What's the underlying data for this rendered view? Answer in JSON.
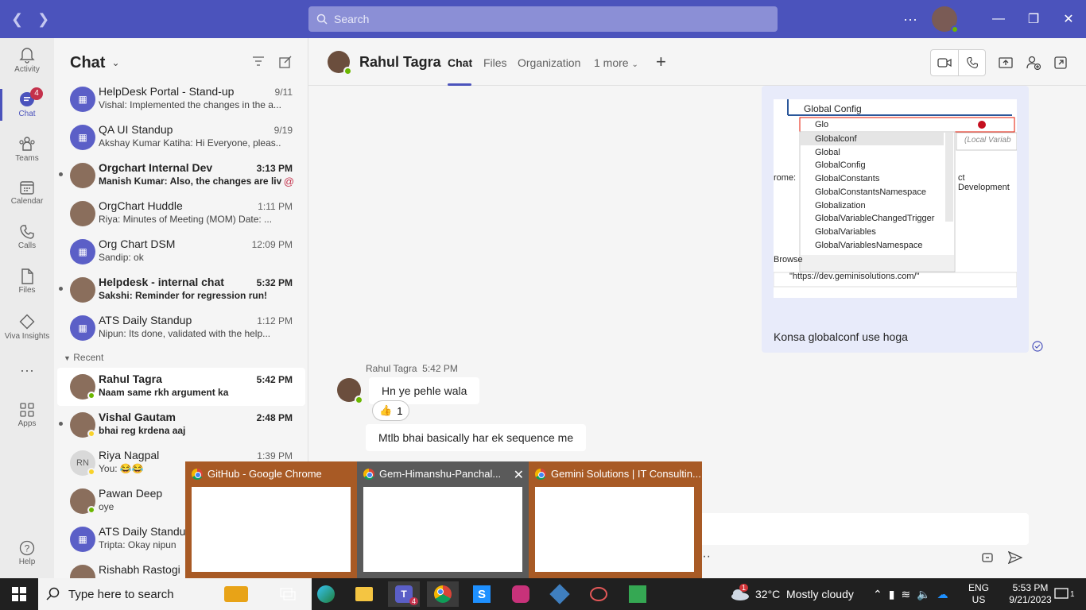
{
  "titlebar": {
    "search_placeholder": "Search",
    "more": "···"
  },
  "rail": {
    "items": [
      {
        "label": "Activity"
      },
      {
        "label": "Chat",
        "badge": "4"
      },
      {
        "label": "Teams"
      },
      {
        "label": "Calendar"
      },
      {
        "label": "Calls"
      },
      {
        "label": "Files"
      },
      {
        "label": "Viva Insights"
      },
      {
        "label": "···"
      },
      {
        "label": "Apps"
      },
      {
        "label": "Help"
      }
    ]
  },
  "sidebar": {
    "title": "Chat",
    "recent_label": "Recent",
    "chats": [
      {
        "name": "HelpDesk Portal - Stand-up",
        "preview": "Vishal: Implemented the changes in the a...",
        "time": "9/11",
        "unread": false,
        "type": "group"
      },
      {
        "name": "QA UI Standup",
        "preview": "Akshay Kumar Katiha: Hi Everyone, pleas...",
        "time": "9/19",
        "unread": false,
        "type": "group"
      },
      {
        "name": "Orgchart Internal Dev",
        "preview": "Manish Kumar: Also, the changes are liv...",
        "time": "3:13 PM",
        "unread": true,
        "type": "photo",
        "mention": "@"
      },
      {
        "name": "OrgChart Huddle",
        "preview": "Riya: Minutes of Meeting (MOM) Date: ...",
        "time": "1:11 PM",
        "unread": false,
        "type": "photo"
      },
      {
        "name": "Org Chart DSM",
        "preview": "Sandip: ok",
        "time": "12:09 PM",
        "unread": false,
        "type": "group"
      },
      {
        "name": "Helpdesk - internal chat",
        "preview": "Sakshi: Reminder for regression run!",
        "time": "5:32 PM",
        "unread": true,
        "type": "photo"
      },
      {
        "name": "ATS Daily Standup",
        "preview": "Nipun: Its done, validated with the help...",
        "time": "1:12 PM",
        "unread": false,
        "type": "group"
      }
    ],
    "recent": [
      {
        "name": "Rahul Tagra",
        "preview": "Naam same rkh argument ka",
        "time": "5:42 PM",
        "unread": true,
        "type": "photo",
        "status": "green",
        "active": true
      },
      {
        "name": "Vishal Gautam",
        "preview": "bhai reg krdena aaj",
        "time": "2:48 PM",
        "unread": true,
        "type": "photo",
        "status": "yellow"
      },
      {
        "name": "Riya Nagpal",
        "preview": "You: 😂😂",
        "time": "1:39 PM",
        "unread": false,
        "type": "init",
        "initials": "RN",
        "status": "yellow"
      },
      {
        "name": "Pawan Deep",
        "preview": "oye",
        "time": "",
        "unread": false,
        "type": "photo",
        "status": "green"
      },
      {
        "name": "ATS Daily Standup",
        "preview": "Tripta: Okay nipun",
        "time": "",
        "unread": false,
        "type": "group"
      },
      {
        "name": "Rishabh Rastogi",
        "preview": "",
        "time": "",
        "unread": false,
        "type": "photo"
      }
    ]
  },
  "chat": {
    "name": "Rahul Tagra",
    "tabs": [
      "Chat",
      "Files",
      "Organization",
      "1 more"
    ],
    "sent_text": "Konsa globalconf use hoga",
    "sender": "Rahul Tagra",
    "sent_time": "5:42 PM",
    "messages": [
      "Hn ye pehle wala",
      "Mtlb bhai basically har ek sequence me"
    ],
    "reaction": {
      "emoji": "👍",
      "count": "1"
    },
    "compose_more": "···"
  },
  "code_screenshot": {
    "header": "Global Config",
    "input": "Glo",
    "local_hint": "(Local Variab",
    "side_text1": "rome:",
    "side_text2": "ct Development",
    "side_text3": "Browse",
    "url_value": "\"https://dev.geminisolutions.com/\"",
    "suggestions": [
      "Globalconf",
      "Global",
      "GlobalConfig",
      "GlobalConstants",
      "GlobalConstantsNamespace",
      "Globalization",
      "GlobalVariableChangedTrigger",
      "GlobalVariables",
      "GlobalVariablesNamespace"
    ]
  },
  "previews": [
    {
      "title": "GitHub - Google Chrome"
    },
    {
      "title": "Gem-Himanshu-Panchal..."
    },
    {
      "title": "Gemini Solutions | IT Consultin..."
    }
  ],
  "taskbar": {
    "search_placeholder": "Type here to search",
    "teams_badge": "4",
    "weather_badge": "1",
    "weather": "32°C  Mostly cloudy",
    "lang": "ENG",
    "region": "US",
    "time": "5:53 PM",
    "date": "9/21/2023",
    "notif": "1"
  }
}
